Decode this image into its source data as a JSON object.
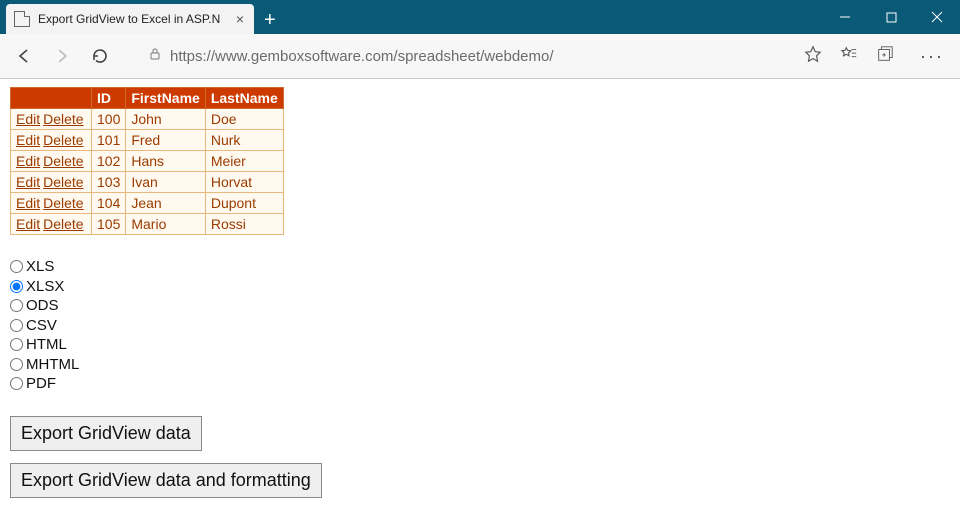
{
  "window": {
    "tab_title": "Export GridView to Excel in ASP.N"
  },
  "address_bar": {
    "url": "https://www.gembox­software.com/spreadsheet/webdemo/"
  },
  "grid": {
    "headers": {
      "col0": "",
      "col1": "ID",
      "col2": "FirstName",
      "col3": "LastName"
    },
    "commands": {
      "edit": "Edit",
      "delete": "Delete"
    },
    "rows": [
      {
        "id": "100",
        "first": "John",
        "last": "Doe"
      },
      {
        "id": "101",
        "first": "Fred",
        "last": "Nurk"
      },
      {
        "id": "102",
        "first": "Hans",
        "last": "Meier"
      },
      {
        "id": "103",
        "first": "Ivan",
        "last": "Horvat"
      },
      {
        "id": "104",
        "first": "Jean",
        "last": "Dupont"
      },
      {
        "id": "105",
        "first": "Mario",
        "last": "Rossi"
      }
    ]
  },
  "formats": {
    "options": [
      {
        "label": "XLS",
        "selected": false
      },
      {
        "label": "XLSX",
        "selected": true
      },
      {
        "label": "ODS",
        "selected": false
      },
      {
        "label": "CSV",
        "selected": false
      },
      {
        "label": "HTML",
        "selected": false
      },
      {
        "label": "MHTML",
        "selected": false
      },
      {
        "label": "PDF",
        "selected": false
      }
    ]
  },
  "buttons": {
    "export_data": "Export GridView data",
    "export_formatted": "Export GridView data and formatting"
  }
}
